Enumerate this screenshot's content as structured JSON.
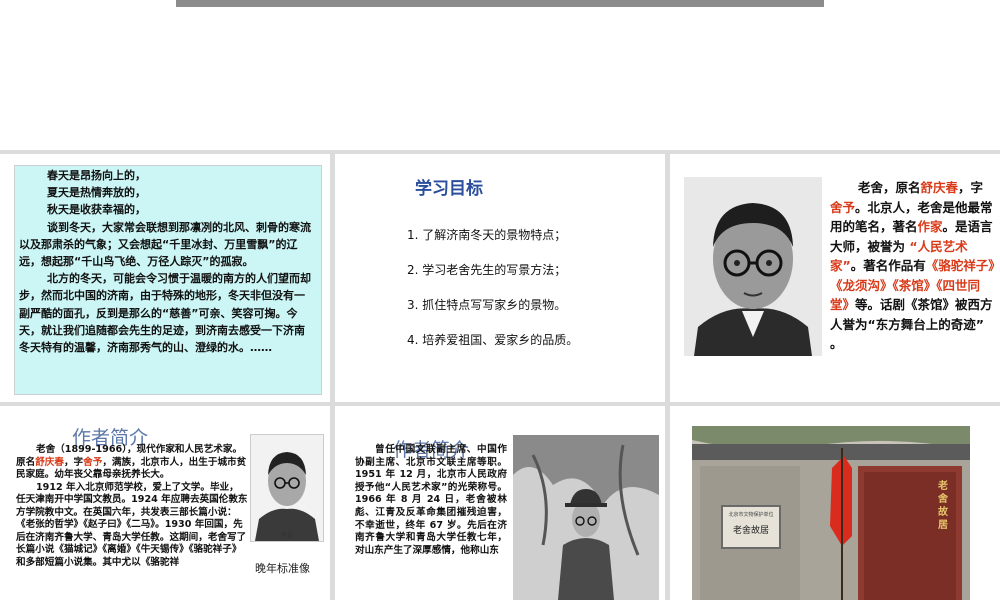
{
  "slide1": {
    "lines": [
      "春天是昂扬向上的，",
      "夏天是热情奔放的，",
      "秋天是收获幸福的，",
      "谈到冬天，大家常会联想到那凛冽的北风、刺骨的寒流以及那肃杀的气象；又会想起“千里冰封、万里雪飘”的辽远，想起那“千山鸟飞绝、万径人踪灭”的孤寂。",
      "北方的冬天，可能会令习惯于温暖的南方的人们望而却步，然而北中国的济南，由于特殊的地形，冬天非但没有一副严酷的面孔，反到是那么的“慈善”可亲、笑容可掬。今天，就让我们追随都会先生的足迹，到济南去感受一下济南冬天特有的温馨，济南那秀气的山、澄绿的水。……"
    ]
  },
  "slide2": {
    "title": "学习目标",
    "goals": [
      "1. 了解济南冬天的景物特点；",
      "2. 学习老舍先生的写景方法；",
      "3. 抓住特点写写家乡的景物。",
      "4. 培养爱祖国、爱家乡的品质。"
    ]
  },
  "slide3": {
    "t1": "老舍，原名",
    "r1": "舒庆春",
    "t2": "，字",
    "r2": "舍予",
    "t3": "。北京人，老舍是他最常用的笔名，著名",
    "r3": "作家",
    "t4": "。是语言大师，被誉为 ",
    "r4": "“人民艺术家”",
    "t5": "。著名作品有",
    "r5": "《骆驼祥子》《龙须沟》《茶馆》《四世同堂》",
    "t6": "等。话剧《茶馆》被西方人誉为“东方舞台上的奇迹” 。"
  },
  "slide4": {
    "title": "作者简介",
    "p1a": "老舍（1899-1966），现代作家和人民艺术家。原名",
    "p1b": "舒庆春",
    "p1c": "，字",
    "p1d": "舍予",
    "p1e": "，满族，北京市人，出生于城市贫民家庭。幼年丧父靠母亲抚养长大。",
    "p2": "1912 年入北京师范学校，爱上了文学。毕业，任天津南开中学国文教员。1924 年应聘去英国伦敦东方学院教中文。在英国六年，共发表三部长篇小说：《老张的哲学》《赵子曰》《二马》。1930 年回国，先后在济南齐鲁大学、青岛大学任教。这期间，老舍写了长篇小说《猫城记》《离婚》《牛天锡传》《骆驼祥子》和多部短篇小说集。其中尤以《骆驼祥",
    "photo_label": "老舍",
    "caption": "晚年标准像"
  },
  "slide5": {
    "title": "作者简介",
    "p": "曾任中国文联副主席、中国作协副主席、北京市文联主席等职。1951 年 12 月，北京市人民政府授予他“人民艺术家”的光荣称号。1966 年 8 月 24 日，老舍被林彪、江青及反革命集团摧残迫害，不幸逝世，终年 67 岁。先后在济南齐鲁大学和青岛大学任教七年，对山东产生了深厚感情，他称山东"
  },
  "slide6": {
    "plaque": "老舍故居",
    "sign": "老舍故居",
    "sign_small": "北京市文物保护单位"
  }
}
